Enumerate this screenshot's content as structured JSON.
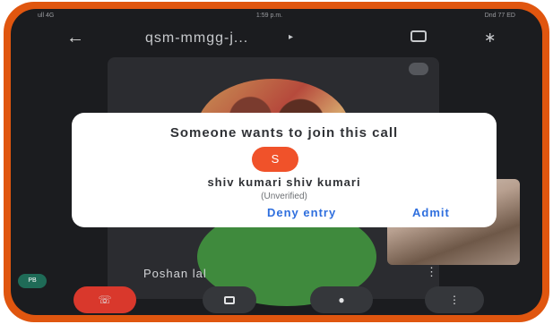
{
  "status_bar": {
    "carrier": "ull 4G",
    "time": "1:59 p.m.",
    "right_status": "Dnd 77 ED"
  },
  "topbar": {
    "meeting_code": "qsm-mmgg-j..."
  },
  "participant": {
    "name": "Poshan lal"
  },
  "dialog": {
    "title": "Someone wants to join this call",
    "requester_initial": "S",
    "requester_name": "shiv kumari shiv kumari",
    "requester_status": "(Unverified)",
    "deny_label": "Deny entry",
    "admit_label": "Admit"
  },
  "self_view": {
    "badge": "PB"
  },
  "colors": {
    "frame": "#e0560f",
    "end_call": "#d9382c",
    "accent": "#2f6fde",
    "requester_avatar": "#f0522a"
  }
}
